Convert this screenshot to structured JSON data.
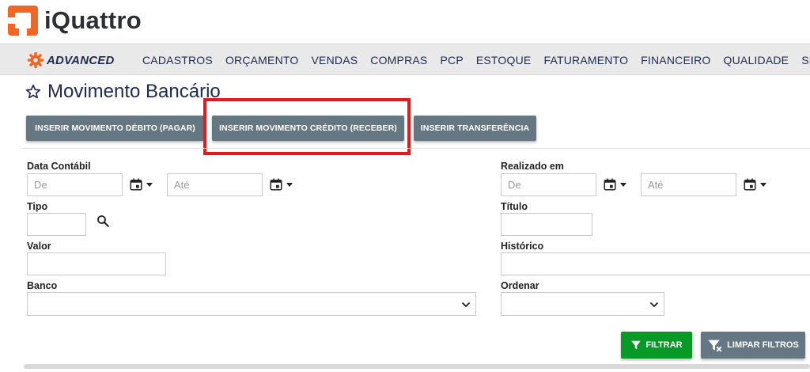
{
  "brand": {
    "name": "iQuattro",
    "accent": "#f26522"
  },
  "nav": {
    "edition": "ADVANCED",
    "items": [
      "CADASTROS",
      "ORÇAMENTO",
      "VENDAS",
      "COMPRAS",
      "PCP",
      "ESTOQUE",
      "FATURAMENTO",
      "FINANCEIRO",
      "QUALIDADE",
      "SPE"
    ]
  },
  "page": {
    "title": "Movimento Bancário"
  },
  "actions": {
    "debit_label": "INSERIR MOVIMENTO DÉBITO (PAGAR)",
    "credit_label": "INSERIR MOVIMENTO CRÉDITO (RECEBER)",
    "transfer_label": "INSERIR TRANSFERÊNCIA"
  },
  "filters": {
    "data_contabil": {
      "label": "Data Contábil",
      "from_placeholder": "De",
      "to_placeholder": "Até"
    },
    "realizado_em": {
      "label": "Realizado em",
      "from_placeholder": "De",
      "to_placeholder": "Até"
    },
    "tipo": {
      "label": "Tipo"
    },
    "titulo": {
      "label": "Título"
    },
    "valor": {
      "label": "Valor"
    },
    "historico": {
      "label": "Histórico"
    },
    "banco": {
      "label": "Banco"
    },
    "ordenar": {
      "label": "Ordenar"
    }
  },
  "buttons": {
    "filter_label": "FILTRAR",
    "clear_label": "LIMPAR FILTROS"
  },
  "colors": {
    "highlight": "#e3191b",
    "filter_button": "#079a27",
    "action_button": "#667784"
  }
}
